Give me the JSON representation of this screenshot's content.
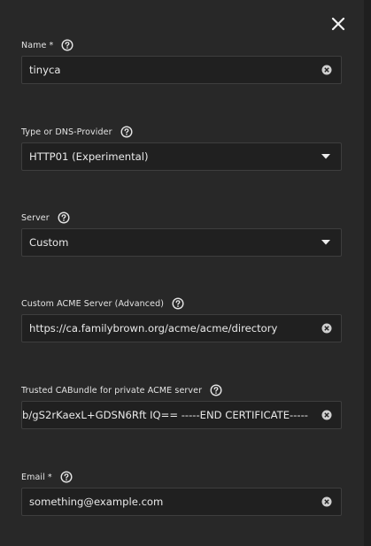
{
  "dialog": {
    "close_icon": "close-icon"
  },
  "fields": {
    "name": {
      "label": "Name",
      "required_mark": "*",
      "value": "tinyca"
    },
    "type": {
      "label": "Type or DNS-Provider",
      "value": "HTTP01 (Experimental)"
    },
    "server": {
      "label": "Server",
      "value": "Custom"
    },
    "custom_acme": {
      "label": "Custom ACME Server (Advanced)",
      "value": "https://ca.familybrown.org/acme/acme/directory"
    },
    "cabundle": {
      "label": "Trusted CABundle for private ACME server",
      "value": "b/gS2rKaexL+GDSN6Rft IQ== -----END CERTIFICATE-----"
    },
    "email": {
      "label": "Email",
      "required_mark": "*",
      "value": "something@example.com"
    }
  },
  "icons": {
    "help": "help-circle-icon",
    "clear": "clear-circle-icon",
    "dropdown": "caret-down-icon"
  },
  "colors": {
    "background": "#282828",
    "input_background": "#202020",
    "input_border": "#3e3e3e",
    "text": "#e6e6e6"
  }
}
